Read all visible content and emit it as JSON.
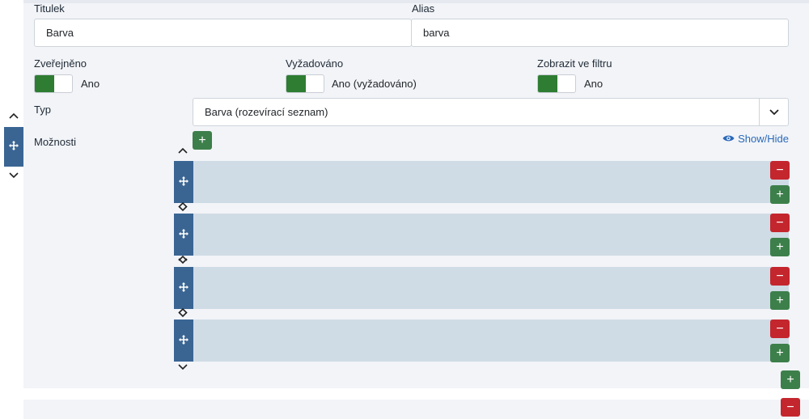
{
  "fields": {
    "title_label": "Titulek",
    "title_value": "Barva",
    "alias_label": "Alias",
    "alias_value": "barva"
  },
  "toggles": [
    {
      "label": "Zveřejněno",
      "state_text": "Ano"
    },
    {
      "label": "Vyžadováno",
      "state_text": "Ano (vyžadováno)"
    },
    {
      "label": "Zobrazit ve filtru",
      "state_text": "Ano"
    }
  ],
  "type": {
    "label": "Typ",
    "selected": "Barva (rozevírací seznam)"
  },
  "options": {
    "label": "Možnosti",
    "show_hide": "Show/Hide",
    "row_count": 4
  },
  "icons": {
    "add": "+",
    "remove": "−",
    "move": "move-icon",
    "chevron_up": "chevron-up-icon",
    "chevron_down": "chevron-down-icon",
    "eye": "eye-icon"
  },
  "colors": {
    "add_button": "#3d7f4a",
    "remove_button": "#c4262e",
    "toggle_on": "#2e7d32",
    "handle": "#3a6593",
    "row_background": "#d0dce5",
    "link": "#2a69b8"
  }
}
